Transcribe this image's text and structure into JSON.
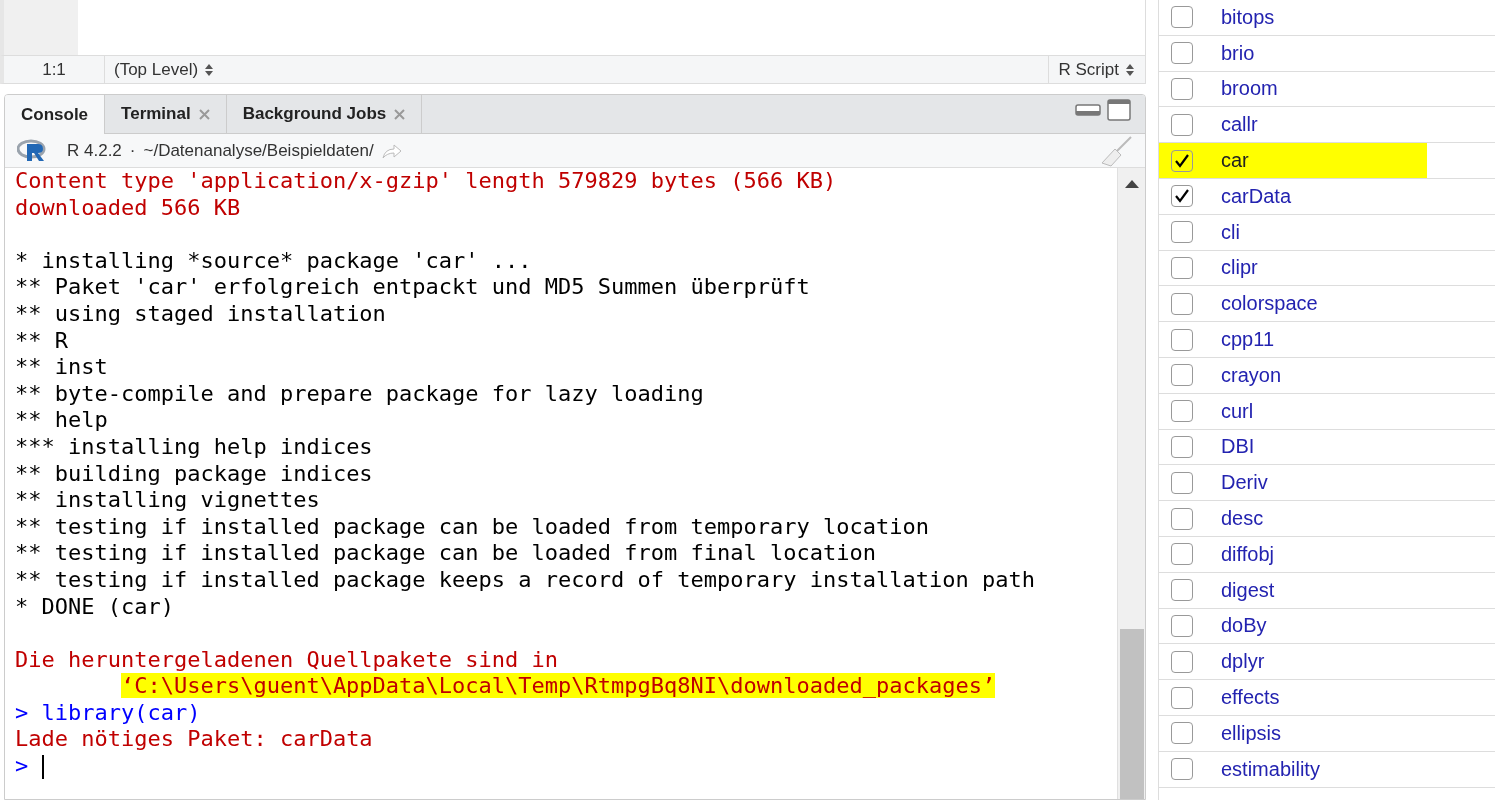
{
  "editor": {
    "status_bar": {
      "position": "1:1",
      "scope": "(Top Level)",
      "file_type": "R Script"
    }
  },
  "console_pane": {
    "tabs": [
      {
        "label": "Console",
        "selected": true,
        "closable": false
      },
      {
        "label": "Terminal",
        "selected": false,
        "closable": true
      },
      {
        "label": "Background Jobs",
        "selected": false,
        "closable": true
      }
    ],
    "version": "R 4.2.2",
    "separator": "·",
    "path": "~/Datenanalyse/Beispieldaten/",
    "lines": [
      {
        "kind": "message",
        "text": "Content type 'application/x-gzip' length 579829 bytes (566 KB)"
      },
      {
        "kind": "message",
        "text": "downloaded 566 KB"
      },
      {
        "kind": "blank"
      },
      {
        "kind": "output",
        "text": "* installing *source* package 'car' ..."
      },
      {
        "kind": "output",
        "text": "** Paket 'car' erfolgreich entpackt und MD5 Summen überprüft"
      },
      {
        "kind": "output",
        "text": "** using staged installation"
      },
      {
        "kind": "output",
        "text": "** R"
      },
      {
        "kind": "output",
        "text": "** inst"
      },
      {
        "kind": "output",
        "text": "** byte-compile and prepare package for lazy loading"
      },
      {
        "kind": "output",
        "text": "** help"
      },
      {
        "kind": "output",
        "text": "*** installing help indices"
      },
      {
        "kind": "output",
        "text": "** building package indices"
      },
      {
        "kind": "output",
        "text": "** installing vignettes"
      },
      {
        "kind": "output",
        "text": "** testing if installed package can be loaded from temporary location"
      },
      {
        "kind": "output",
        "text": "** testing if installed package can be loaded from final location"
      },
      {
        "kind": "output",
        "text": "** testing if installed package keeps a record of temporary installation path"
      },
      {
        "kind": "output",
        "text": "* DONE (car)"
      },
      {
        "kind": "blank"
      },
      {
        "kind": "message",
        "text": "Die heruntergeladenen Quellpakete sind in"
      },
      {
        "kind": "message",
        "text": "‘C:\\Users\\guent\\AppData\\Local\\Temp\\RtmpgBq8NI\\downloaded_packages’",
        "indented": true,
        "highlighted": true
      },
      {
        "kind": "input",
        "prompt": ">",
        "text": "library(car)"
      },
      {
        "kind": "message",
        "text": "Lade nötiges Paket: carData"
      },
      {
        "kind": "input",
        "prompt": ">",
        "cursor": true
      }
    ]
  },
  "packages": [
    {
      "name": "bitops",
      "checked": false,
      "highlighted": false
    },
    {
      "name": "brio",
      "checked": false,
      "highlighted": false
    },
    {
      "name": "broom",
      "checked": false,
      "highlighted": false
    },
    {
      "name": "callr",
      "checked": false,
      "highlighted": false
    },
    {
      "name": "car",
      "checked": true,
      "highlighted": true
    },
    {
      "name": "carData",
      "checked": true,
      "highlighted": false
    },
    {
      "name": "cli",
      "checked": false,
      "highlighted": false
    },
    {
      "name": "clipr",
      "checked": false,
      "highlighted": false
    },
    {
      "name": "colorspace",
      "checked": false,
      "highlighted": false
    },
    {
      "name": "cpp11",
      "checked": false,
      "highlighted": false
    },
    {
      "name": "crayon",
      "checked": false,
      "highlighted": false
    },
    {
      "name": "curl",
      "checked": false,
      "highlighted": false
    },
    {
      "name": "DBI",
      "checked": false,
      "highlighted": false
    },
    {
      "name": "Deriv",
      "checked": false,
      "highlighted": false
    },
    {
      "name": "desc",
      "checked": false,
      "highlighted": false
    },
    {
      "name": "diffobj",
      "checked": false,
      "highlighted": false
    },
    {
      "name": "digest",
      "checked": false,
      "highlighted": false
    },
    {
      "name": "doBy",
      "checked": false,
      "highlighted": false
    },
    {
      "name": "dplyr",
      "checked": false,
      "highlighted": false
    },
    {
      "name": "effects",
      "checked": false,
      "highlighted": false
    },
    {
      "name": "ellipsis",
      "checked": false,
      "highlighted": false
    },
    {
      "name": "estimability",
      "checked": false,
      "highlighted": false
    }
  ]
}
